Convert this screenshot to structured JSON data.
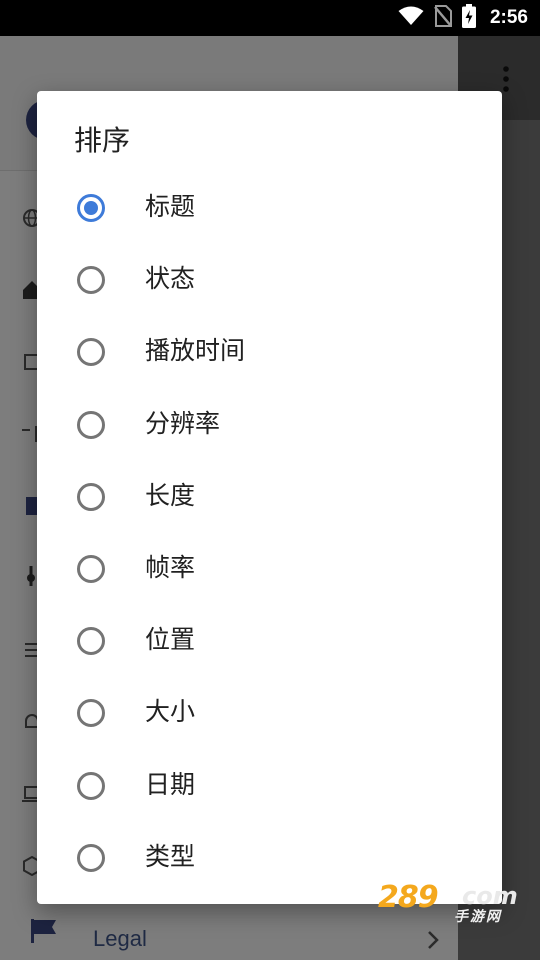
{
  "status_bar": {
    "time": "2:56",
    "icons": [
      "wifi-icon",
      "no-sim-icon",
      "battery-charging-icon"
    ]
  },
  "background": {
    "legal_label": "Legal",
    "icons": [
      "globe-icon",
      "home-icon",
      "crop-icon",
      "stream-icon",
      "folder-icon",
      "equalizer-icon",
      "menu-icon",
      "bell-icon",
      "laptop-icon",
      "hexagon-icon",
      "flag-icon",
      "chevron-right-icon",
      "overflow-menu-icon"
    ]
  },
  "watermark": {
    "brand": "289",
    "domain": "com",
    "subtitle": "手游网"
  },
  "dialog": {
    "title": "排序",
    "selected_index": 0,
    "options": [
      {
        "label": "标题"
      },
      {
        "label": "状态"
      },
      {
        "label": "播放时间"
      },
      {
        "label": "分辨率"
      },
      {
        "label": "长度"
      },
      {
        "label": "帧率"
      },
      {
        "label": "位置"
      },
      {
        "label": "大小"
      },
      {
        "label": "日期"
      },
      {
        "label": "类型"
      }
    ]
  },
  "colors": {
    "accent": "#3e7bd9",
    "radio_unchecked": "#757575",
    "scrim_panel": "#7d7d7d",
    "status_bar": "#000000"
  }
}
